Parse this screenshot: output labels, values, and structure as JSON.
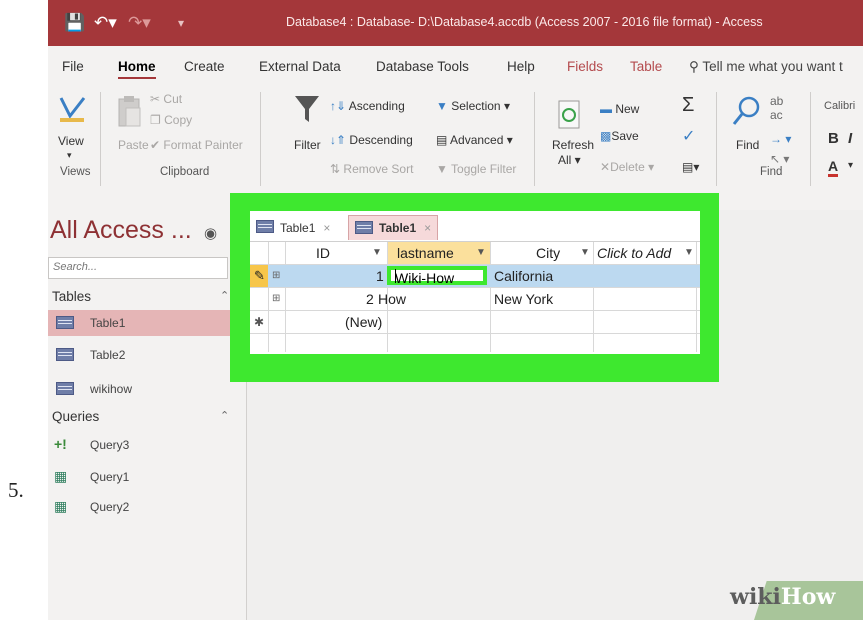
{
  "step_number": "5.",
  "window": {
    "title": "Database4 : Database- D:\\Database4.accdb (Access 2007 - 2016 file format)  -  Access"
  },
  "ribbon_tabs": [
    "File",
    "Home",
    "Create",
    "External Data",
    "Database Tools",
    "Help",
    "Fields",
    "Table",
    "Tell me what you want t"
  ],
  "ribbon": {
    "views": {
      "view": "View",
      "group": "Views"
    },
    "clipboard": {
      "cut": "Cut",
      "copy": "Copy",
      "paste": "Paste",
      "format_painter": "Format Painter",
      "group": "Clipboard"
    },
    "sort_filter": {
      "filter": "Filter",
      "ascending": "Ascending",
      "descending": "Descending",
      "remove_sort": "Remove Sort",
      "selection": "Selection",
      "advanced": "Advanced",
      "toggle_filter": "Toggle Filter"
    },
    "records": {
      "refresh": "Refresh",
      "all": "All",
      "new": "New",
      "save": "Save",
      "delete": "Delete"
    },
    "find": {
      "find": "Find",
      "group": "Find"
    },
    "text": {
      "font": "Calibri",
      "bold": "B",
      "italic": "I",
      "font_color": "A"
    }
  },
  "nav_pane": {
    "title": "All Access ...",
    "search_placeholder": "Search...",
    "sections": [
      {
        "name": "Tables",
        "items": [
          "Table1",
          "Table2",
          "wikihow"
        ]
      },
      {
        "name": "Queries",
        "items": [
          "Query3",
          "Query1",
          "Query2"
        ]
      }
    ]
  },
  "document_tabs": [
    {
      "label": "Table1",
      "close": "×"
    },
    {
      "label": "Table1",
      "close": "×"
    }
  ],
  "datasheet": {
    "columns": [
      "ID",
      "lastname",
      "City",
      "Click to Add"
    ],
    "rows": [
      {
        "id": "1",
        "lastname": "Wiki-How",
        "city": "California"
      },
      {
        "id": "2",
        "lastname": "How",
        "city": "New York"
      }
    ],
    "new_row": "(New)"
  },
  "colors": {
    "accent": "#a4373a",
    "highlight": "#3ee82f",
    "selected_row": "#bcd9f0"
  },
  "watermark": {
    "prefix": "wiki",
    "suffix": "How"
  }
}
